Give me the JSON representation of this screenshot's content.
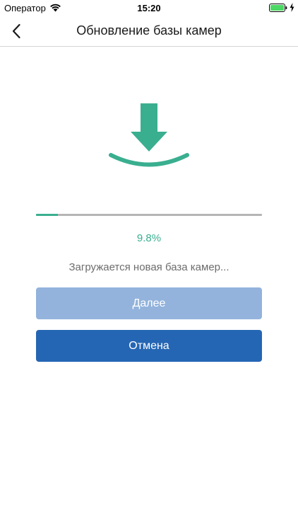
{
  "status_bar": {
    "carrier": "Оператор",
    "time": "15:20",
    "icons": [
      "wifi-icon",
      "battery-icon",
      "charging-bolt-icon"
    ]
  },
  "nav": {
    "back_icon": "chevron-left-icon",
    "title": "Обновление базы камер"
  },
  "illustration": {
    "icon": "download-arrow-icon",
    "color": "#3aaf90"
  },
  "progress": {
    "value": 0.098,
    "label": "9.8%",
    "message": "Загружается новая база камер...",
    "fill_color": "#3aaf90",
    "track_color": "#b5b5b5"
  },
  "buttons": {
    "next_label": "Далее",
    "next_state": "disabled",
    "cancel_label": "Отмена",
    "primary_color": "#2566b4",
    "disabled_color": "#93b3dc"
  }
}
